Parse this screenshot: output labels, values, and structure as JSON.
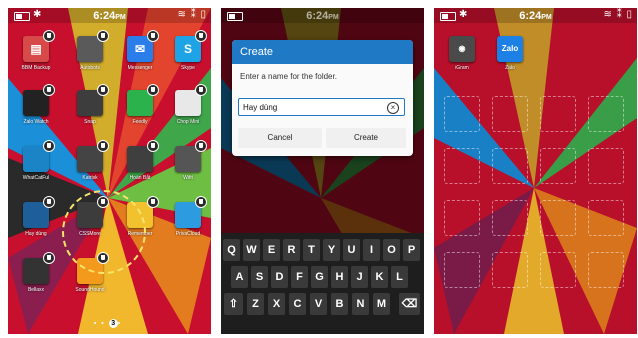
{
  "status_bar": {
    "time": "6:24",
    "time_suffix": "PM"
  },
  "screen1": {
    "apps": [
      {
        "label": "BBM Backup",
        "color": "#d84a4a",
        "glyph": "▤"
      },
      {
        "label": "Autobots",
        "color": "#5a5a5a",
        "glyph": ""
      },
      {
        "label": "Messenger",
        "color": "#2b7de9",
        "glyph": "✉"
      },
      {
        "label": "Skype",
        "color": "#1ea3e6",
        "glyph": "S"
      },
      {
        "label": "Zalo Watch",
        "color": "#222222",
        "glyph": ""
      },
      {
        "label": "Snap",
        "color": "#3d3d3d",
        "glyph": ""
      },
      {
        "label": "Feedly",
        "color": "#2bb24c",
        "glyph": ""
      },
      {
        "label": "Chop Mini",
        "color": "#e8e8e8",
        "glyph": ""
      },
      {
        "label": "WhatCatFul",
        "color": "#1a84c6",
        "glyph": ""
      },
      {
        "label": "Katrisk",
        "color": "#444444",
        "glyph": ""
      },
      {
        "label": "Hoàn Bắt",
        "color": "#3f3f3f",
        "glyph": ""
      },
      {
        "label": "Wifit",
        "color": "#555555",
        "glyph": ""
      },
      {
        "label": "Hay dùng",
        "color": "#1e5f9a",
        "glyph": ""
      },
      {
        "label": "CSSMore",
        "color": "#3c3c3c",
        "glyph": ""
      },
      {
        "label": "Remember",
        "color": "#f2c12e",
        "glyph": ""
      },
      {
        "label": "PrivaCloud",
        "color": "#2d9be0",
        "glyph": ""
      },
      {
        "label": "Bellaxx",
        "color": "#333333",
        "glyph": ""
      },
      {
        "label": "SoundHound",
        "color": "#f39a1d",
        "glyph": ""
      }
    ],
    "page_indicator": "3"
  },
  "screen2": {
    "dialog": {
      "title": "Create",
      "prompt": "Enter a name for the folder.",
      "input_value": "Hay dùng",
      "cancel": "Cancel",
      "create": "Create"
    },
    "keyboard": {
      "row1": [
        "Q",
        "W",
        "E",
        "R",
        "T",
        "Y",
        "U",
        "I",
        "O",
        "P"
      ],
      "row2": [
        "A",
        "S",
        "D",
        "F",
        "G",
        "H",
        "J",
        "K",
        "L"
      ],
      "row3": [
        "Z",
        "X",
        "C",
        "V",
        "B",
        "N",
        "M"
      ]
    }
  },
  "screen3": {
    "apps": [
      {
        "label": "iGram",
        "color": "#4a4a4a"
      },
      {
        "label": "Zalo",
        "color": "#1c80e5",
        "glyph": "Zalo"
      }
    ]
  }
}
